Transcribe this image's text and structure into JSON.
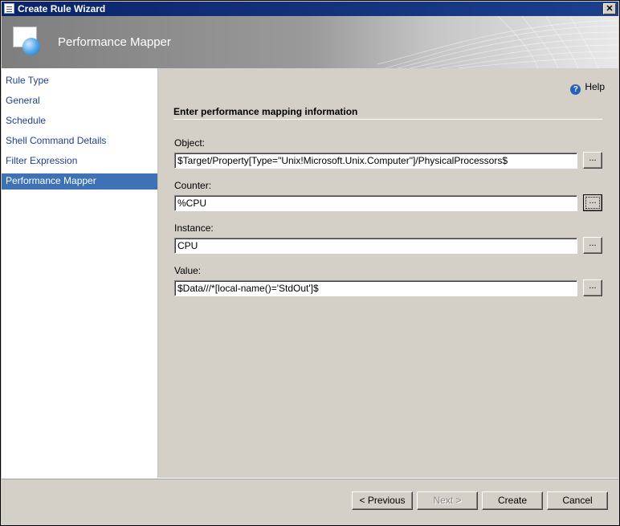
{
  "window": {
    "title": "Create Rule Wizard",
    "close_label": "✕"
  },
  "header": {
    "title": "Performance Mapper"
  },
  "sidebar": {
    "items": [
      {
        "label": "Rule Type"
      },
      {
        "label": "General"
      },
      {
        "label": "Schedule"
      },
      {
        "label": "Shell Command Details"
      },
      {
        "label": "Filter Expression"
      },
      {
        "label": "Performance Mapper"
      }
    ],
    "active_index": 5
  },
  "main": {
    "help_label": "Help",
    "heading": "Enter performance mapping information",
    "fields": {
      "object": {
        "label": "Object:",
        "value": "$Target/Property[Type=\"Unix!Microsoft.Unix.Computer\"]/PhysicalProcessors$"
      },
      "counter": {
        "label": "Counter:",
        "value": "%CPU"
      },
      "instance": {
        "label": "Instance:",
        "value": "CPU"
      },
      "value": {
        "label": "Value:",
        "value": "$Data///*[local-name()='StdOut']$"
      }
    },
    "browse_label": "..."
  },
  "footer": {
    "previous_label": "< Previous",
    "next_label": "Next >",
    "create_label": "Create",
    "cancel_label": "Cancel"
  },
  "colors": {
    "title_bar": "#0a246a",
    "nav_active": "#3d72b5",
    "nav_link": "#1f3f8e",
    "dialog_bg": "#d4d0c8"
  }
}
